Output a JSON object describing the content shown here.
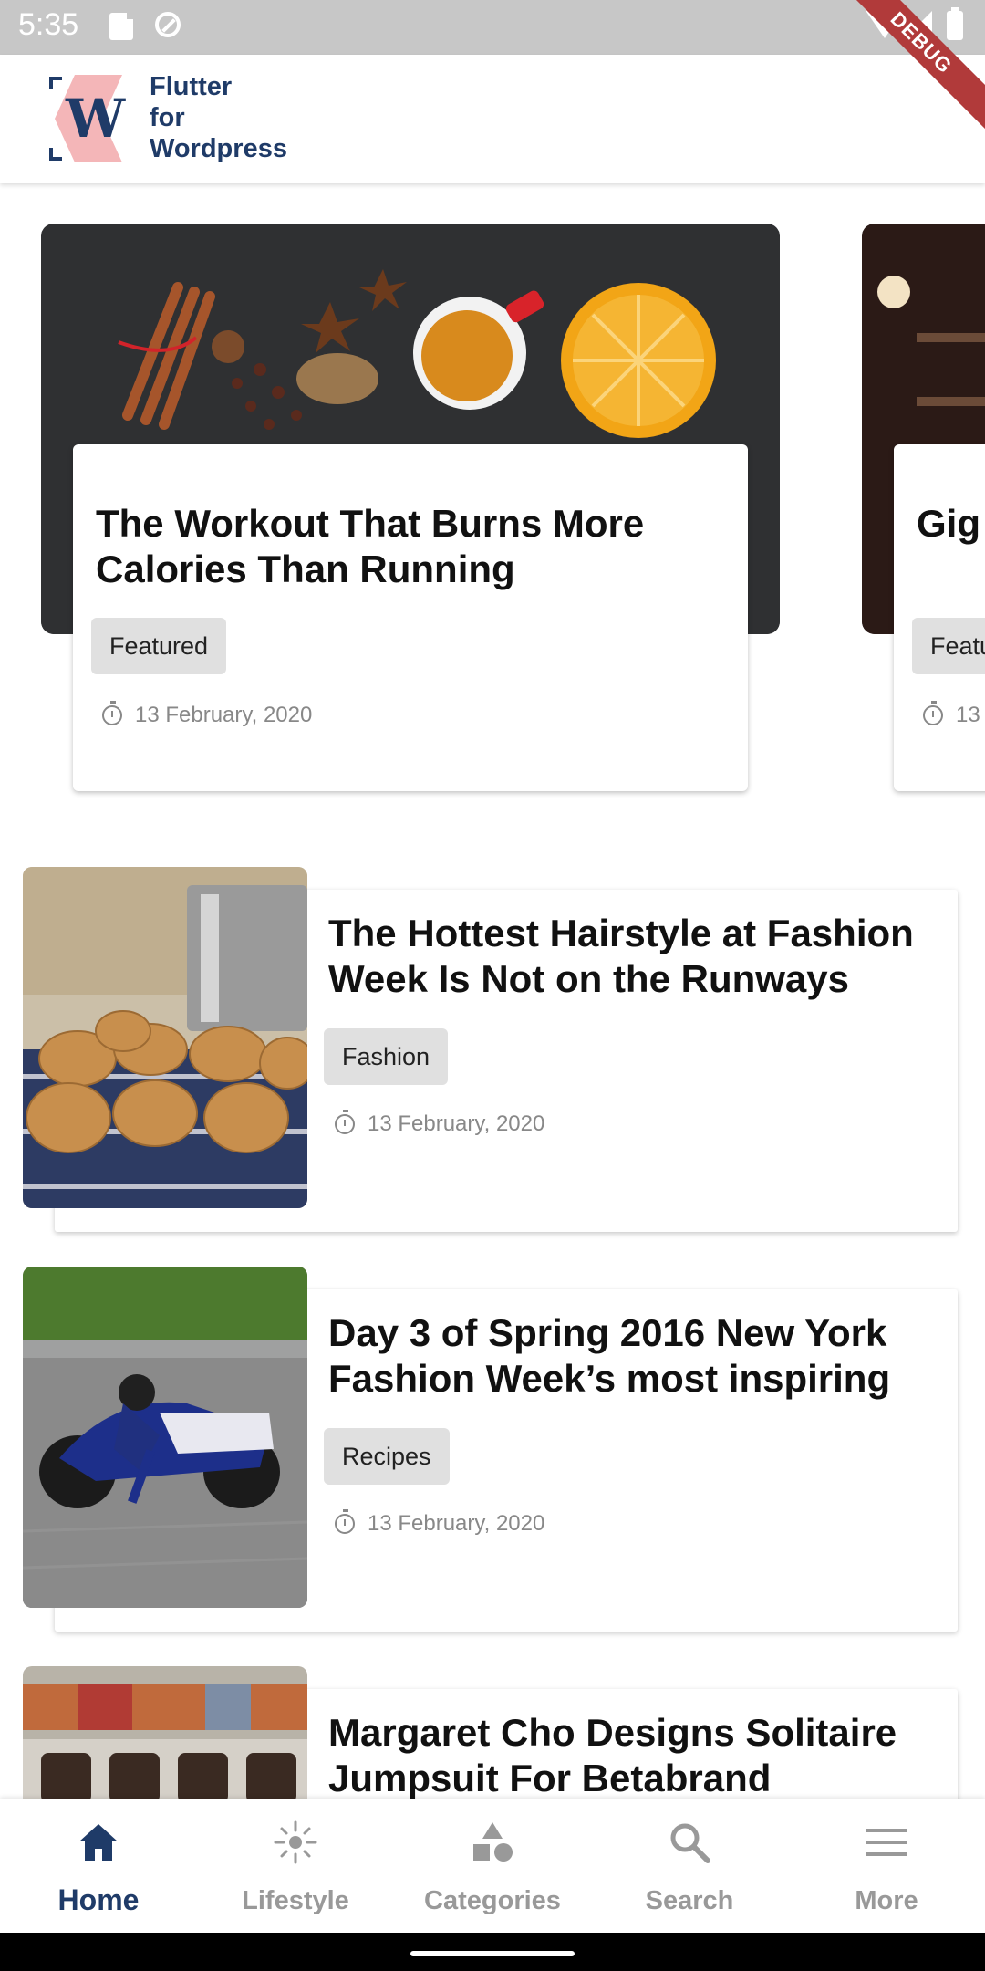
{
  "status_bar": {
    "time": "5:35"
  },
  "debug_banner": "DEBUG",
  "app_bar": {
    "brand": "Flutter\nfor\nWordpress"
  },
  "featured": [
    {
      "title": "The Workout That Burns More Calories Than Running",
      "category": "Featured",
      "date": "13 February, 2020"
    },
    {
      "title": "Gig Rev",
      "category": "Featu",
      "date": "13"
    }
  ],
  "posts": [
    {
      "title": "The Hottest Hairstyle at Fashion Week Is Not on the Runways",
      "category": "Fashion",
      "date": "13 February, 2020"
    },
    {
      "title": "Day 3 of Spring 2016 New York Fashion Week’s most inspiring",
      "category": "Recipes",
      "date": "13 February, 2020"
    },
    {
      "title": "Margaret Cho Designs Solitaire Jumpsuit For Betabrand",
      "category": "",
      "date": ""
    }
  ],
  "bottom_nav": {
    "items": [
      {
        "label": "Home",
        "icon": "home-icon",
        "active": true
      },
      {
        "label": "Lifestyle",
        "icon": "sun-icon",
        "active": false
      },
      {
        "label": "Categories",
        "icon": "shapes-icon",
        "active": false
      },
      {
        "label": "Search",
        "icon": "search-icon",
        "active": false
      },
      {
        "label": "More",
        "icon": "menu-icon",
        "active": false
      }
    ]
  },
  "colors": {
    "brand": "#1f3b68",
    "chip_bg": "#e0e0e0",
    "inactive": "#999999"
  }
}
